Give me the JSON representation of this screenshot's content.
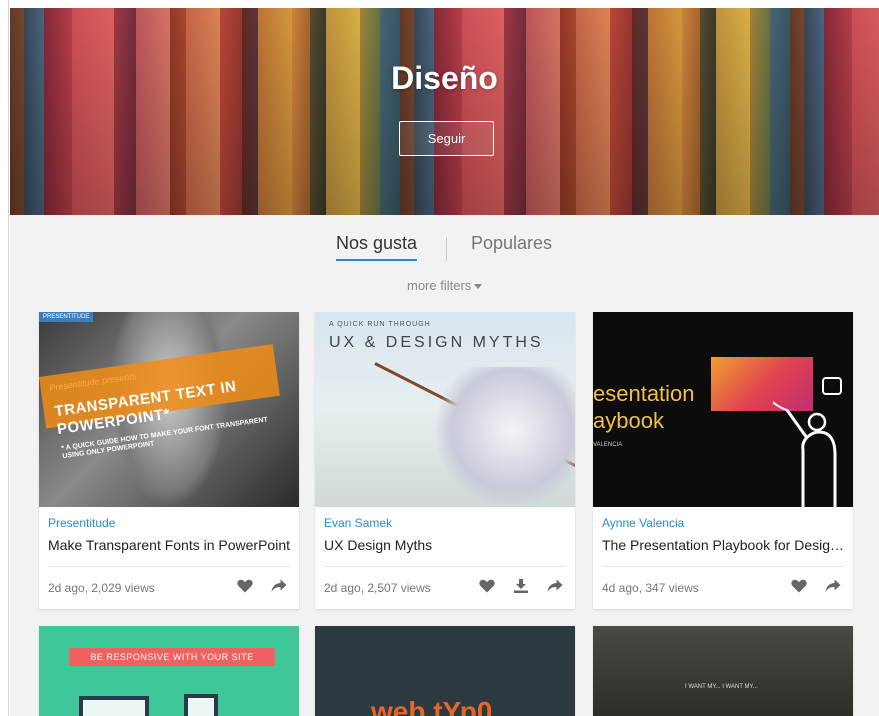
{
  "hero": {
    "title": "Diseño",
    "follow_label": "Seguir"
  },
  "tabs": [
    {
      "label": "Nos gusta",
      "active": true
    },
    {
      "label": "Populares",
      "active": false
    }
  ],
  "filters_label": "more filters",
  "accent_color": "#2a8bd0",
  "cards": [
    {
      "author": "Presentitude",
      "title": "Make Transparent Fonts in PowerPoint",
      "meta": "2d ago, 2,029 views",
      "actions": [
        "heart-icon",
        "share-icon"
      ],
      "thumb": {
        "badge": "PRESENTITUDE",
        "script": "Presentitude presents",
        "headline": "TRANSPARENT TEXT IN POWERPOINT*",
        "sub": "* A QUICK GUIDE HOW TO MAKE YOUR FONT TRANSPARENT USING ONLY POWERPOINT"
      }
    },
    {
      "author": "Evan Samek",
      "title": "UX Design Myths",
      "meta": "2d ago, 2,507 views",
      "actions": [
        "heart-icon",
        "download-icon",
        "share-icon"
      ],
      "thumb": {
        "small": "A QUICK RUN THROUGH",
        "headline": "UX & DESIGN MYTHS"
      }
    },
    {
      "author": "Aynne Valencia",
      "title": "The Presentation Playbook for Designers",
      "meta": "4d ago, 347 views",
      "actions": [
        "heart-icon",
        "share-icon"
      ],
      "thumb": {
        "headline_line1": "esentation",
        "headline_line2": "aybook",
        "author_text": "VALENCIA"
      }
    }
  ],
  "row2": [
    {
      "text": "BE RESPONSIVE WITH YOUR SITE"
    },
    {
      "text": "web tYp0"
    },
    {
      "text": "I WANT MY... I WANT MY..."
    }
  ]
}
